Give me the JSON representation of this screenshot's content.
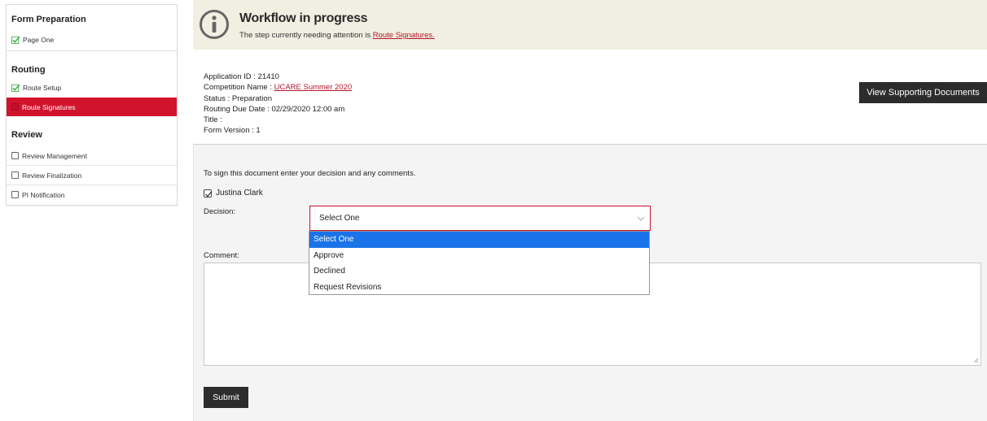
{
  "sidebar": {
    "sections": [
      {
        "title": "Form Preparation",
        "items": [
          {
            "label": "Page One",
            "state": "complete"
          }
        ]
      },
      {
        "title": "Routing",
        "items": [
          {
            "label": "Route Setup",
            "state": "complete"
          },
          {
            "label": "Route Signatures",
            "state": "active"
          }
        ]
      },
      {
        "title": "Review",
        "items": [
          {
            "label": "Review Management",
            "state": "pending"
          },
          {
            "label": "Review Finalization",
            "state": "pending"
          },
          {
            "label": "PI Notification",
            "state": "pending"
          }
        ]
      }
    ]
  },
  "banner": {
    "icon": "info-icon",
    "title": "Workflow in progress",
    "subtitle_prefix": "The step currently needing attention is ",
    "subtitle_link": "Route Signatures."
  },
  "application": {
    "id_label": "Application ID : ",
    "id_value": "21410",
    "competition_label": "Competition Name : ",
    "competition_value": "UCARE Summer 2020",
    "status_label": "Status : ",
    "status_value": "Preparation",
    "due_label": "Routing Due Date : ",
    "due_value": "02/29/2020 12:00 am",
    "title_label": "Title : ",
    "title_value": "",
    "version_label": "Form Version : ",
    "version_value": "1"
  },
  "actions": {
    "supporting_docs": "View Supporting Documents",
    "submit": "Submit"
  },
  "form": {
    "instructions": "To sign this document enter your decision and any comments.",
    "signer_name": "Justina Clark",
    "decision_label": "Decision:",
    "decision_value": "Select One",
    "decision_options": [
      "Select One",
      "Approve",
      "Declined",
      "Request Revisions"
    ],
    "comment_label": "Comment:",
    "comment_value": ""
  },
  "colors": {
    "accent_red": "#d2132d",
    "check_green": "#4caf50",
    "selected_blue": "#1a73e8",
    "banner_bg": "#f0efe2",
    "dark_button": "#2c2c2c"
  }
}
